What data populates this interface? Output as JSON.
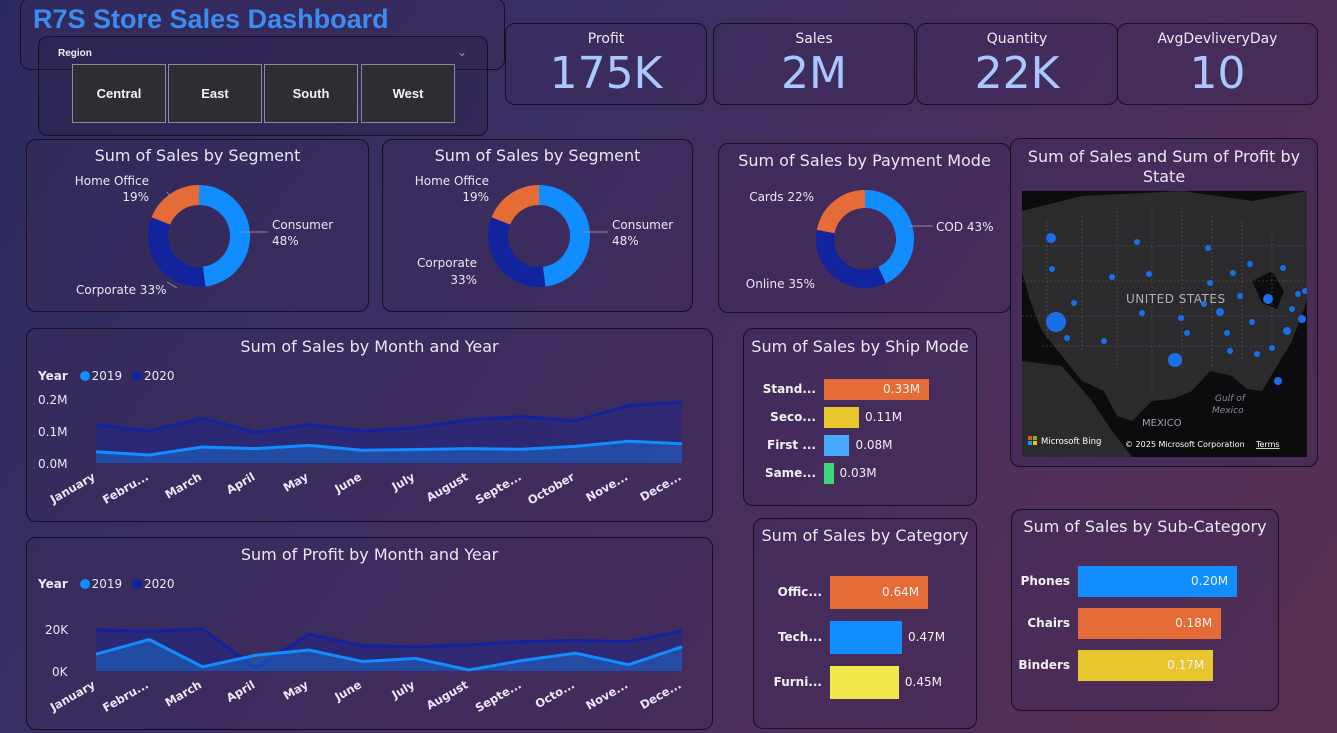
{
  "header": {
    "title": "R7S Store Sales Dashboard"
  },
  "slicer": {
    "label": "Region",
    "options": [
      "Central",
      "East",
      "South",
      "West"
    ]
  },
  "kpis": [
    {
      "label": "Profit",
      "value": "175K"
    },
    {
      "label": "Sales",
      "value": "2M"
    },
    {
      "label": "Quantity",
      "value": "22K"
    },
    {
      "label": "AvgDevliveryDay",
      "value": "10"
    }
  ],
  "colors": {
    "consumer": "#118dff",
    "corporate": "#12239e",
    "home_office": "#e66c37",
    "series_2019": "#118dff",
    "series_2020": "#12239e",
    "yellow": "#e8c62e",
    "light_blue": "#4aa8ff",
    "green": "#3fd67a",
    "bright_yellow": "#f2ea4a"
  },
  "donut1": {
    "title": "Sum of Sales by Segment",
    "labels": {
      "home_office_name": "Home Office",
      "home_office_pct": "19%",
      "consumer_name": "Consumer",
      "consumer_pct": "48%",
      "corporate": "Corporate 33%"
    }
  },
  "donut2": {
    "title": "Sum of Sales by Segment",
    "labels": {
      "home_office_name": "Home Office",
      "home_office_pct": "19%",
      "consumer_name": "Consumer",
      "consumer_pct": "48%",
      "corporate_name": "Corporate",
      "corporate_pct": "33%"
    }
  },
  "donut3": {
    "title": "Sum of Sales by Payment Mode",
    "labels": {
      "cards": "Cards 22%",
      "cod": "COD 43%",
      "online": "Online 35%"
    }
  },
  "map": {
    "title_line1": "Sum of Sales and Sum of Profit by",
    "title_line2": "State",
    "country_label": "UNITED STATES",
    "mexico_label": "MEXICO",
    "gulf_line1": "Gulf of",
    "gulf_line2": "Mexico",
    "attribution_logo": "Microsoft Bing",
    "copyright": "© 2025 Microsoft Corporation",
    "terms": "Terms"
  },
  "area_sales": {
    "title": "Sum of Sales by Month and Year",
    "legend_title": "Year",
    "y_ticks": [
      "0.2M",
      "0.1M",
      "0.0M"
    ]
  },
  "area_profit": {
    "title": "Sum of Profit by Month and Year",
    "legend_title": "Year",
    "y_ticks": [
      "20K",
      "0K"
    ]
  },
  "ship_mode": {
    "title": "Sum of Sales by Ship Mode"
  },
  "category": {
    "title": "Sum of Sales by Category"
  },
  "subcategory": {
    "title": "Sum of Sales by Sub-Category"
  },
  "chart_data": [
    {
      "type": "pie",
      "title": "Sum of Sales by Segment",
      "categories": [
        "Consumer",
        "Corporate",
        "Home Office"
      ],
      "values": [
        48,
        33,
        19
      ]
    },
    {
      "type": "pie",
      "title": "Sum of Sales by Segment",
      "categories": [
        "Consumer",
        "Corporate",
        "Home Office"
      ],
      "values": [
        48,
        33,
        19
      ]
    },
    {
      "type": "pie",
      "title": "Sum of Sales by Payment Mode",
      "categories": [
        "COD",
        "Online",
        "Cards"
      ],
      "values": [
        43,
        35,
        22
      ]
    },
    {
      "type": "area",
      "title": "Sum of Sales by Month and Year",
      "categories": [
        "January",
        "Febru...",
        "March",
        "April",
        "May",
        "June",
        "July",
        "August",
        "Septe...",
        "October",
        "Nove...",
        "Dece..."
      ],
      "legend_title": "Year",
      "series": [
        {
          "name": "2019",
          "values": [
            0.035,
            0.025,
            0.05,
            0.045,
            0.055,
            0.04,
            0.042,
            0.045,
            0.043,
            0.052,
            0.068,
            0.06
          ]
        },
        {
          "name": "2020",
          "values": [
            0.12,
            0.1,
            0.14,
            0.095,
            0.12,
            0.1,
            0.11,
            0.135,
            0.145,
            0.132,
            0.18,
            0.19
          ]
        }
      ],
      "ylim": [
        0,
        0.2
      ]
    },
    {
      "type": "area",
      "title": "Sum of Profit by Month and Year",
      "categories": [
        "January",
        "Febru...",
        "March",
        "April",
        "May",
        "June",
        "July",
        "August",
        "Septe...",
        "Octo...",
        "Nove...",
        "Dece..."
      ],
      "legend_title": "Year",
      "series": [
        {
          "name": "2019",
          "values": [
            8000,
            15000,
            2000,
            7500,
            10000,
            4500,
            6000,
            500,
            5000,
            8500,
            3000,
            11500
          ]
        },
        {
          "name": "2020",
          "values": [
            19500,
            19000,
            20000,
            1500,
            17500,
            12000,
            11500,
            12500,
            14000,
            14500,
            14000,
            19000
          ]
        }
      ],
      "ylim": [
        0,
        30000
      ]
    },
    {
      "type": "bar",
      "title": "Sum of Sales by Ship Mode",
      "categories": [
        "Stand...",
        "Seco...",
        "First ...",
        "Same..."
      ],
      "values": [
        0.33,
        0.11,
        0.08,
        0.03
      ],
      "value_labels": [
        "0.33M",
        "0.11M",
        "0.08M",
        "0.03M"
      ],
      "orientation": "horizontal"
    },
    {
      "type": "bar",
      "title": "Sum of Sales by Category",
      "categories": [
        "Offic...",
        "Tech...",
        "Furni..."
      ],
      "values": [
        0.64,
        0.47,
        0.45
      ],
      "value_labels": [
        "0.64M",
        "0.47M",
        "0.45M"
      ],
      "orientation": "horizontal"
    },
    {
      "type": "bar",
      "title": "Sum of Sales by Sub-Category",
      "categories": [
        "Phones",
        "Chairs",
        "Binders"
      ],
      "values": [
        0.2,
        0.18,
        0.17
      ],
      "value_labels": [
        "0.20M",
        "0.18M",
        "0.17M"
      ],
      "orientation": "horizontal"
    }
  ]
}
